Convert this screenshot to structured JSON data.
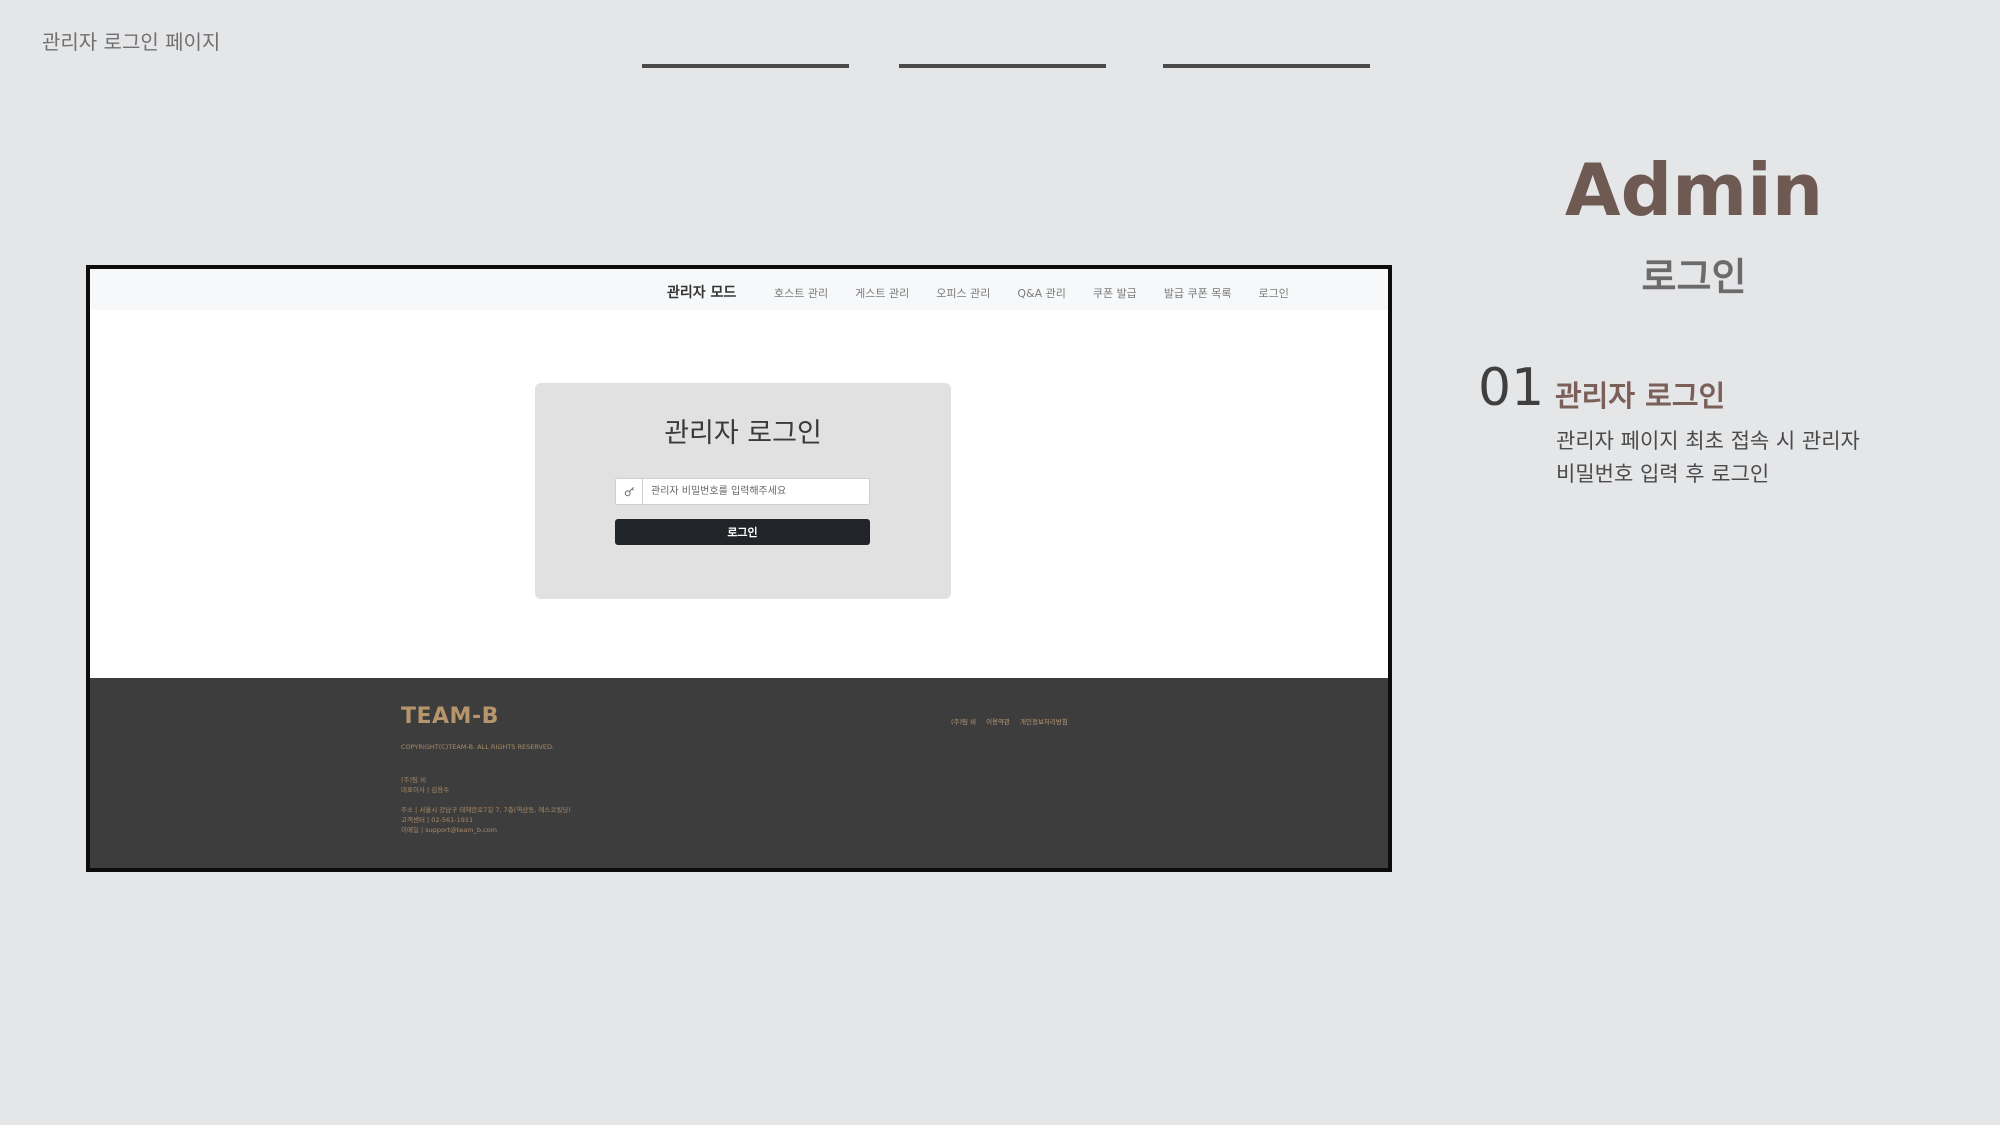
{
  "page_label": "관리자 로그인 페이지",
  "screenshot": {
    "navbar": {
      "brand": "관리자 모드",
      "links": [
        "호스트 관리",
        "게스트 관리",
        "오피스 관리",
        "Q&A 관리",
        "쿠폰 발급",
        "발급 쿠폰 목록",
        "로그인"
      ]
    },
    "login": {
      "title": "관리자 로그인",
      "password_placeholder": "관리자 비밀번호를 입력해주세요",
      "button": "로그인"
    },
    "footer": {
      "logo": "TEAM-B",
      "copyright": "COPYRIGHT(C)TEAM-B. ALL RIGHTS RESERVED.",
      "company": "(주)팀 비",
      "ceo": "대표이사 | 김용수",
      "address": "주소 | 서울시 강남구 테헤란로7길 7, 7층(역삼동, 에스코빌딩)",
      "phone": "고객센터 | 02-561-1911",
      "email": "이메일 | support@team_b.com",
      "links": [
        "(주)팀 비",
        "이용약관",
        "개인정보처리방침"
      ]
    }
  },
  "panel": {
    "title": "Admin",
    "subtitle": "로그인",
    "step_number": "01",
    "step_title": "관리자 로그인",
    "step_desc_line1": "관리자 페이지 최초 접속 시 관리자",
    "step_desc_line2": "비밀번호 입력 후 로그인"
  },
  "colors": {
    "background": "#e5e6e8",
    "accent_brown": "#6e5a52",
    "footer_bg": "#3d3d3d",
    "footer_logo": "#b7956c",
    "button_dark": "#212529"
  },
  "icons": [
    "key-icon"
  ]
}
